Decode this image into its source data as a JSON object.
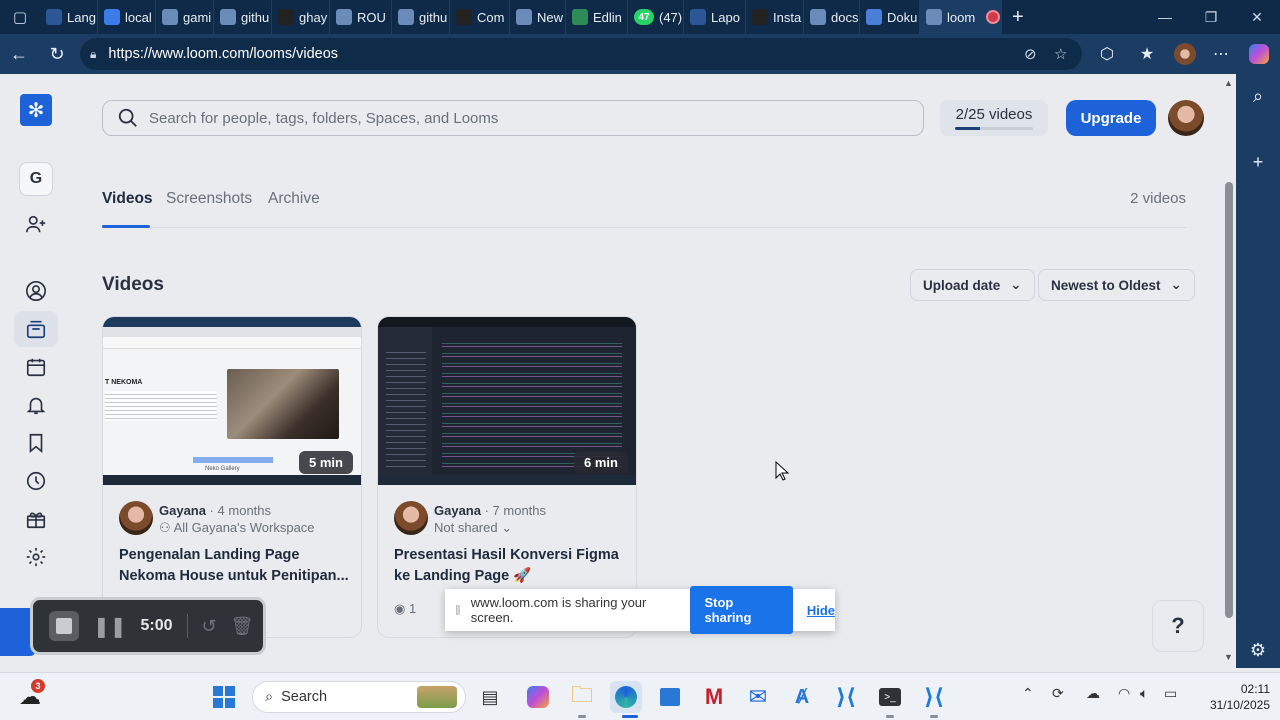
{
  "browser": {
    "tabs": [
      {
        "label": "Lang",
        "icon": "document-icon",
        "color": "#2b5797"
      },
      {
        "label": "local",
        "icon": "app-icon",
        "color": "#3b7de8"
      },
      {
        "label": "gami",
        "icon": "search-icon",
        "color": "#6b8bb8"
      },
      {
        "label": "githu",
        "icon": "search-icon",
        "color": "#6b8bb8"
      },
      {
        "label": "ghay",
        "icon": "github-icon",
        "color": "#222222"
      },
      {
        "label": "ROU",
        "icon": "wifi-icon",
        "color": "#6b8bb8"
      },
      {
        "label": "githu",
        "icon": "search-icon",
        "color": "#6b8bb8"
      },
      {
        "label": "Com",
        "icon": "github-icon",
        "color": "#222222"
      },
      {
        "label": "New",
        "icon": "newtab-icon",
        "color": "#6b8bb8"
      },
      {
        "label": "Edlin",
        "icon": "edlink-icon",
        "color": "#2e8b57"
      },
      {
        "label": "(47)",
        "icon": "whatsapp-icon",
        "color": "#25d366",
        "badge": "47"
      },
      {
        "label": "Lapo",
        "icon": "word-icon",
        "color": "#2b5797"
      },
      {
        "label": "Insta",
        "icon": "instagram-icon",
        "color": "#222222"
      },
      {
        "label": "docs",
        "icon": "search-icon",
        "color": "#6b8bb8"
      },
      {
        "label": "Doku",
        "icon": "docs-icon",
        "color": "#4a7fd6"
      },
      {
        "label": "loom",
        "icon": "search-icon",
        "color": "#6b8bb8"
      }
    ],
    "url": "https://www.loom.com/looms/videos"
  },
  "loom": {
    "workspace_initial": "G",
    "search_placeholder": "Search for people, tags, folders, Spaces, and Looms",
    "video_count_label": "2/25 videos",
    "video_usage_fraction": 0.08,
    "upgrade_label": "Upgrade",
    "tabs": [
      "Videos",
      "Screenshots",
      "Archive"
    ],
    "total_label": "2 videos",
    "section_title": "Videos",
    "sort_by": "Upload date",
    "sort_order": "Newest to Oldest",
    "videos": [
      {
        "duration": "5 min",
        "owner": "Gayana",
        "age": "· 4 months",
        "sharing": "All Gayana's Workspace",
        "title": "Pengenalan Landing Page Nekoma House untuk Penitipan...",
        "thumb_heading": "T NEKOMA",
        "thumb_caption": "Neko Gallery"
      },
      {
        "duration": "6 min",
        "owner": "Gayana",
        "age": "· 7 months",
        "sharing": "Not shared",
        "title": "Presentasi Hasil Konversi Figma ke Landing Page 🚀",
        "views": "1"
      }
    ],
    "help_label": "?"
  },
  "screen_share": {
    "message": "www.loom.com is sharing your screen.",
    "stop_label": "Stop sharing",
    "hide_label": "Hide"
  },
  "recorder": {
    "elapsed": "5:00"
  },
  "taskbar": {
    "search_label": "Search",
    "weather_badge": "3",
    "time": "02:11",
    "date": "31/10/2025"
  }
}
